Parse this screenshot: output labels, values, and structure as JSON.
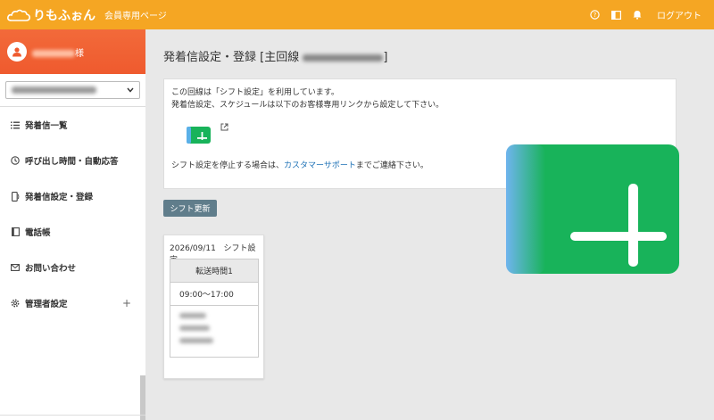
{
  "header": {
    "logo_text": "りもふぉん",
    "site_subtitle": "会員専用ページ",
    "logout_label": "ログアウト",
    "icons": [
      "help-icon",
      "book-icon",
      "bell-icon"
    ],
    "bg_color": "#f5a623"
  },
  "sidebar": {
    "user_suffix": "様",
    "accent_color": "#ef5a2e",
    "items": [
      {
        "label": "発着信一覧",
        "icon": "list-icon"
      },
      {
        "label": "呼び出し時間・自動応答",
        "icon": "clock-icon"
      },
      {
        "label": "発着信設定・登録",
        "icon": "phone-icon"
      },
      {
        "label": "電話帳",
        "icon": "phonebook-icon"
      },
      {
        "label": "お問い合わせ",
        "icon": "mail-icon"
      },
      {
        "label": "管理者設定",
        "icon": "gear-icon",
        "expand": "+"
      }
    ]
  },
  "main": {
    "title_prefix": "発着信設定・登録 [主回線 ",
    "title_suffix": "]",
    "info": {
      "line1": "この回線は「シフト設定」を利用しています。",
      "line2": "発着信設定、スケジュールは以下のお客様専用リンクから設定して下さい。",
      "support_prefix": "シフト設定を停止する場合は、",
      "support_link": "カスタマーサポート",
      "support_suffix": "までご連絡下さい。"
    },
    "shift_button": "シフト更新",
    "shift_card": {
      "date": "2026/09/11",
      "label": "シフト設定",
      "table_header": "転送時間1",
      "time_range": "09:00〜17:00"
    }
  }
}
